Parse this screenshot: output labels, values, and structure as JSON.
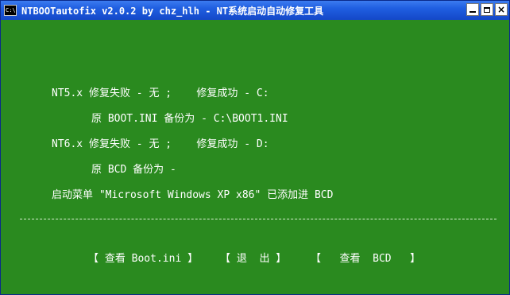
{
  "window": {
    "title": "NTBOOTautofix v2.0.2 by chz_hlh - NT系统启动自动修复工具",
    "icon_label": "C:\\",
    "icon_name": "console-icon",
    "buttons": {
      "minimize": "minimize-icon",
      "maximize": "maximize-icon",
      "close": "close-icon",
      "close_glyph": "×"
    },
    "colors": {
      "console_background": "#2a8a1f",
      "console_text": "#ffffff",
      "titlebar": "#1f5ee0"
    }
  },
  "console": {
    "lines": [
      "NT5.x 修复失败 - 无 ;    修复成功 - C:",
      "原 BOOT.INI 备份为 - C:\\BOOT1.INI",
      "NT6.x 修复失败 - 无 ;    修复成功 - D:",
      "原 BCD 备份为 -",
      "启动菜单 \"Microsoft Windows XP x86\" 已添加进 BCD"
    ],
    "menu": {
      "view_boot_ini": "【 查看 Boot.ini 】",
      "exit": "【 退  出 】",
      "view_bcd": "【   查看  BCD   】"
    }
  }
}
